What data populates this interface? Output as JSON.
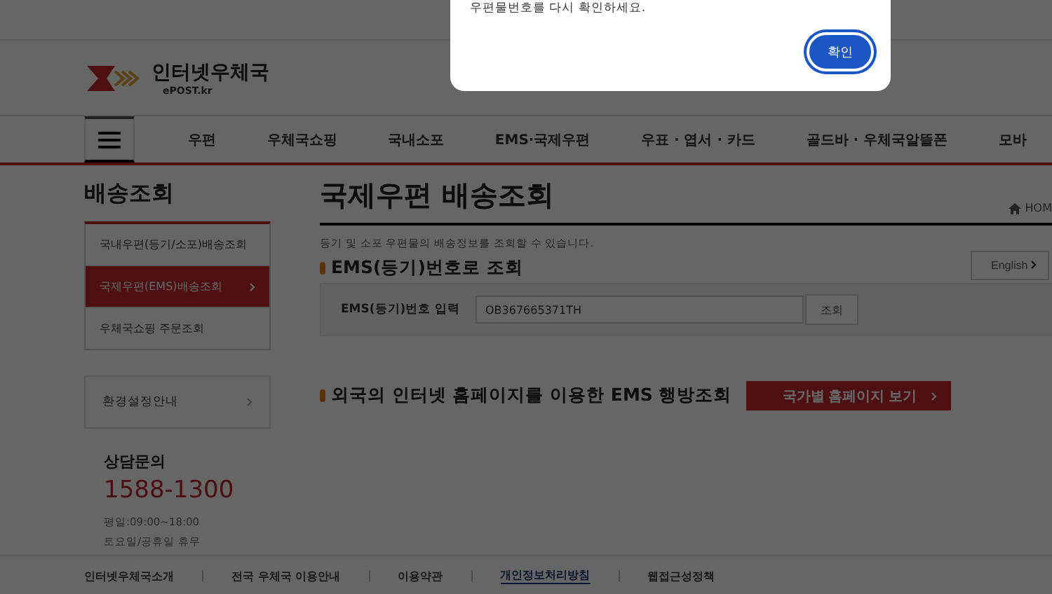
{
  "header": {
    "logo_title": "인터넷우체국",
    "logo_subtitle": "ePOST.kr"
  },
  "nav": {
    "items": [
      {
        "label": "우편"
      },
      {
        "label": "우체국쇼핑"
      },
      {
        "label": "국내소포"
      },
      {
        "label": "EMS·국제우편"
      },
      {
        "label": "우표 · 엽서 · 카드"
      },
      {
        "label": "골드바 · 우체국알뜰폰"
      },
      {
        "label": "모바"
      }
    ]
  },
  "sidebar": {
    "title": "배송조회",
    "items": [
      {
        "label": "국내우편(등기/소포)배송조회",
        "selected": false
      },
      {
        "label": "국제우편(EMS)배송조회",
        "selected": true
      },
      {
        "label": "우체국쇼핑 주문조회",
        "selected": false
      }
    ],
    "settings_link": "환경설정안내",
    "contact_title": "상담문의",
    "phone": "1588-1300",
    "hours": [
      "평일:09:00~18:00",
      "토요일/공휴일 휴무"
    ]
  },
  "main": {
    "title": "국제우편 배송조회",
    "breadcrumb": "HOM",
    "description": "등기 및 소포 우편물의 배송정보를 조회할 수 있습니다.",
    "section1_title": "EMS(등기)번호로 조회",
    "english_button": "English",
    "input_label": "EMS(등기)번호 입력",
    "input_value": "OB367665371TH",
    "search_button": "조회",
    "section2_title": "외국의 인터넷 홈페이지를 이용한 EMS 행방조회",
    "country_button": "국가별 홈페이지 보기"
  },
  "footer": {
    "links": [
      {
        "label": "인터넷우체국소개",
        "selected": false
      },
      {
        "label": "전국 우체국 이용안내",
        "selected": false
      },
      {
        "label": "이용약관",
        "selected": false
      },
      {
        "label": "개인정보처리방침",
        "selected": true
      },
      {
        "label": "웹접근성정책",
        "selected": false
      }
    ]
  },
  "dialog": {
    "message": "우편물번호를 다시 확인하세요.",
    "ok_button": "확인"
  }
}
